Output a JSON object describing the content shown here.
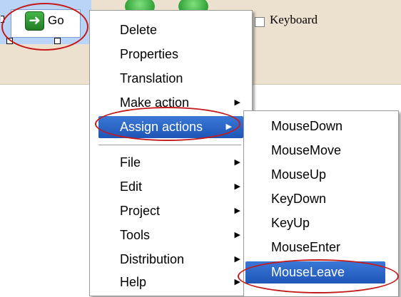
{
  "canvas": {
    "go_button_label": "Go",
    "keyboard_checkbox_label": "Keyboard"
  },
  "context_menu": {
    "items": [
      {
        "label": "Delete",
        "submenu": false
      },
      {
        "label": "Properties",
        "submenu": false
      },
      {
        "label": "Translation",
        "submenu": false
      },
      {
        "label": "Make action",
        "submenu": true
      },
      {
        "label": "Assign actions",
        "submenu": true,
        "highlighted": true
      },
      {
        "label": "File",
        "submenu": true
      },
      {
        "label": "Edit",
        "submenu": true
      },
      {
        "label": "Project",
        "submenu": true
      },
      {
        "label": "Tools",
        "submenu": true
      },
      {
        "label": "Distribution",
        "submenu": true
      },
      {
        "label": "Help",
        "submenu": true
      }
    ]
  },
  "assign_actions_submenu": {
    "items": [
      {
        "label": "MouseDown"
      },
      {
        "label": "MouseMove"
      },
      {
        "label": "MouseUp"
      },
      {
        "label": "KeyDown"
      },
      {
        "label": "KeyUp"
      },
      {
        "label": "MouseEnter"
      },
      {
        "label": "MouseLeave",
        "highlighted": true
      }
    ]
  },
  "colors": {
    "highlight": "#2a66c8",
    "annotation": "#c41a1a",
    "canvas_background": "#ece1ce",
    "selection": "#b9d4f6"
  },
  "icons": {
    "go_arrow": "arrow-right-icon",
    "submenu_arrow": "triangle-right-icon"
  }
}
